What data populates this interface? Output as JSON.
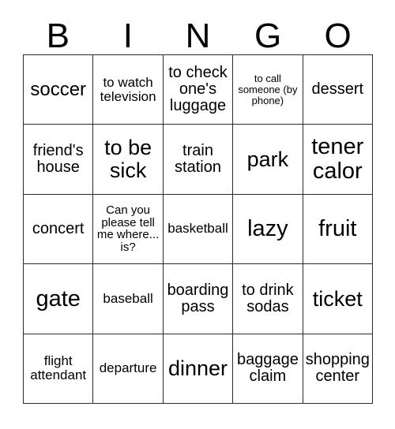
{
  "card": {
    "header": {
      "letters": [
        "B",
        "I",
        "N",
        "G",
        "O"
      ]
    },
    "rows": [
      [
        {
          "text": "soccer",
          "size": "fs-l"
        },
        {
          "text": "to watch television",
          "size": "fs-s"
        },
        {
          "text": "to check one's luggage",
          "size": "fs-m"
        },
        {
          "text": "to call someone (by phone)",
          "size": "fs-xxs"
        },
        {
          "text": "dessert",
          "size": "fs-m"
        }
      ],
      [
        {
          "text": "friend's house",
          "size": "fs-m"
        },
        {
          "text": "to be sick",
          "size": "fs-xl"
        },
        {
          "text": "train station",
          "size": "fs-m"
        },
        {
          "text": "park",
          "size": "fs-xl"
        },
        {
          "text": "tener calor",
          "size": "fs-xxl"
        }
      ],
      [
        {
          "text": "concert",
          "size": "fs-m"
        },
        {
          "text": "Can you please tell me where... is?",
          "size": "fs-xs"
        },
        {
          "text": "basketball",
          "size": "fs-s"
        },
        {
          "text": "lazy",
          "size": "fs-xxl"
        },
        {
          "text": "fruit",
          "size": "fs-xxl"
        }
      ],
      [
        {
          "text": "gate",
          "size": "fs-xxl"
        },
        {
          "text": "baseball",
          "size": "fs-s"
        },
        {
          "text": "boarding pass",
          "size": "fs-m"
        },
        {
          "text": "to drink sodas",
          "size": "fs-m"
        },
        {
          "text": "ticket",
          "size": "fs-xl"
        }
      ],
      [
        {
          "text": "flight attendant",
          "size": "fs-s"
        },
        {
          "text": "departure",
          "size": "fs-s"
        },
        {
          "text": "dinner",
          "size": "fs-xl"
        },
        {
          "text": "baggage claim",
          "size": "fs-m"
        },
        {
          "text": "shopping center",
          "size": "fs-m"
        }
      ]
    ]
  },
  "style": {
    "border_color": "#2b2b2b",
    "text_color": "#000000",
    "background": "#ffffff"
  }
}
